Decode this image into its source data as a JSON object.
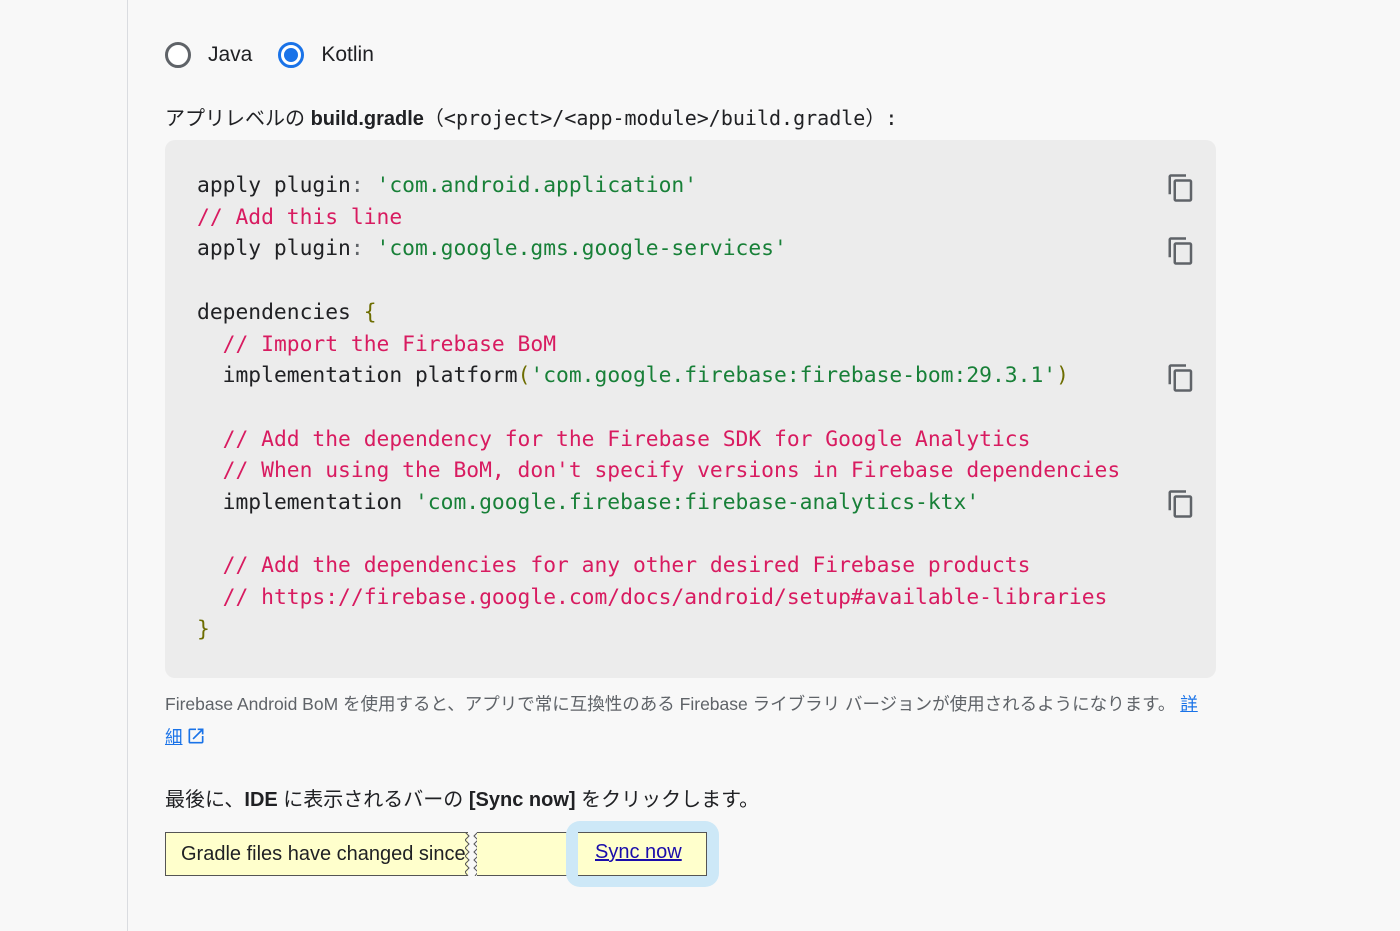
{
  "language_toggle": {
    "options": [
      {
        "label": "Java",
        "selected": false
      },
      {
        "label": "Kotlin",
        "selected": true
      }
    ]
  },
  "intro": {
    "prefix": "アプリレベルの ",
    "file_name": "build.gradle",
    "path": "（<project>/<app-module>/build.gradle）:"
  },
  "code": {
    "l1_kw": "apply plugin",
    "l1_pun": ": ",
    "l1_str": "'com.android.application'",
    "l2_cm": "// Add this line",
    "l3_kw": "apply plugin",
    "l3_pun": ": ",
    "l3_str": "'com.google.gms.google-services'",
    "l5_kw": "dependencies ",
    "l5_br": "{",
    "l6_cm": "// Import the Firebase BoM",
    "l7_kw": "implementation platform",
    "l7_open": "(",
    "l7_str": "'com.google.firebase:firebase-bom:29.3.1'",
    "l7_close": ")",
    "l9_cm": "// Add the dependency for the Firebase SDK for Google Analytics",
    "l10_cm": "// When using the BoM, don't specify versions in Firebase dependencies",
    "l11_kw": "implementation ",
    "l11_str": "'com.google.firebase:firebase-analytics-ktx'",
    "l13_cm": "// Add the dependencies for any other desired Firebase products",
    "l14_cm": "// https://firebase.google.com/docs/android/setup#available-libraries",
    "l15_br": "}"
  },
  "copy_buttons": [
    "copy-icon",
    "copy-icon",
    "copy-icon",
    "copy-icon"
  ],
  "note": {
    "text": "Firebase Android BoM を使用すると、アプリで常に互換性のある Firebase ライブラリ バージョンが使用されるようになります。 ",
    "link": "詳細",
    "link_icon": "external-link-icon"
  },
  "final_step": {
    "prefix": "最後に、",
    "ide": "IDE",
    "middle": " に表示されるバーの ",
    "button": "[Sync now]",
    "suffix": " をクリックします。"
  },
  "sync_bar": {
    "message": "Gradle files have changed since last project sync",
    "link": "Sync now",
    "background": "#ffffcc",
    "highlight": "#cde8f7"
  },
  "colors": {
    "accent": "#1a73e8",
    "comment": "#d81b60",
    "string": "#188038",
    "code_bg": "#ececec"
  }
}
